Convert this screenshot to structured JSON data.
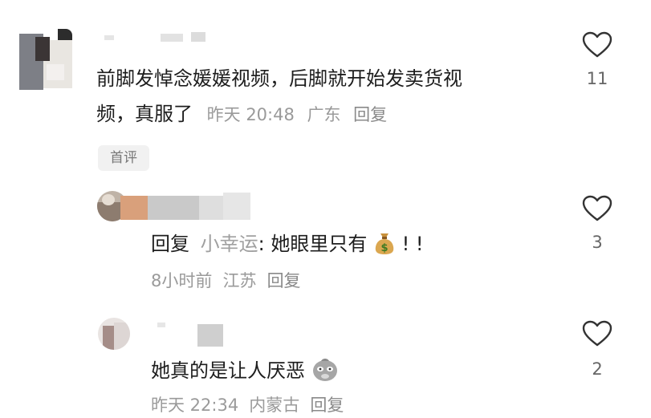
{
  "comments": [
    {
      "text_line1": "前脚发悼念媛媛视频，后脚就开始发卖货视",
      "text_line2": "频，真服了",
      "time": "昨天 20:48",
      "location": "广东",
      "reply_label": "回复",
      "likes": "11",
      "badge": "首评"
    },
    {
      "reply_prefix": "回复",
      "mention": "小幸运",
      "text": ": 她眼里只有",
      "text_suffix": " ! !",
      "emoji": "money-bag",
      "time": "8小时前",
      "location": "江苏",
      "reply_label": "回复",
      "likes": "3"
    },
    {
      "text": "她真的是让人厌恶",
      "emoji": "unamused-face",
      "time": "昨天 22:34",
      "location": "内蒙古",
      "reply_label": "回复",
      "likes": "2"
    }
  ],
  "colors": {
    "text": "#1d1d1d",
    "meta": "#9a9a9a",
    "mention": "#a0a0a0",
    "badge_bg": "#f1f1f1"
  }
}
